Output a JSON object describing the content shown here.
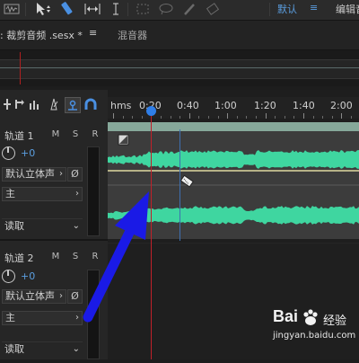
{
  "toolbar": {
    "tools": [
      "waveform-view-icon",
      "move-tool-icon",
      "razor-tool-icon",
      "time-selection-icon",
      "slip-tool-icon",
      "marquee-icon",
      "lasso-icon",
      "brush-icon",
      "spot-heal-icon"
    ],
    "workspace_label": "默认",
    "workspace_menu": "≡",
    "edit_label": "编辑音"
  },
  "tabs": {
    "file_tab": ": 裁剪音频 .sesx *",
    "menu_glyph": "≡",
    "mixer_tab": "混音器"
  },
  "ruler": {
    "unit": "hms",
    "labels": [
      "0:20",
      "0:40",
      "1:00",
      "1:20",
      "1:40",
      "2:00"
    ]
  },
  "tracks": [
    {
      "name": "轨道 1",
      "mute": "M",
      "solo": "S",
      "record": "R",
      "volume": "+0",
      "output": "默认立体声",
      "input": "主",
      "phase": "Ø",
      "automation": "读取"
    },
    {
      "name": "轨道 2",
      "mute": "M",
      "solo": "S",
      "record": "R",
      "volume": "+0",
      "output": "默认立体声",
      "input": "主",
      "phase": "Ø",
      "automation": "读取"
    }
  ],
  "arrow_annotation_color": "#1a1ae6",
  "waveform_color": "#3fd6a0",
  "playhead_color": "#c0202a",
  "accent_color": "#5b9ee0",
  "watermark": {
    "brand": "Bai",
    "subtitle": "经验",
    "url": "jingyan.baidu.com"
  }
}
